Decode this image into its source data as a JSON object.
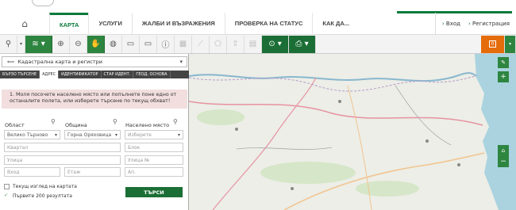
{
  "header": {
    "nav": [
      {
        "label": "КАРТА",
        "active": true
      },
      {
        "label": "УСЛУГИ"
      },
      {
        "label": "ЖАЛБИ И ВЪЗРАЖЕНИЯ"
      },
      {
        "label": "ПРОВЕРКА НА СТАТУС"
      },
      {
        "label": "КАК ДА..."
      }
    ],
    "login_label": "Вход",
    "register_label": "Регистрация"
  },
  "toolbar": {
    "counter": "0"
  },
  "panel": {
    "layer_select": "Кадастрална карта и регистри",
    "tabs": [
      "БЪРЗО ТЪРСЕНЕ",
      "АДРЕС",
      "ИДЕНТИФИКАТОР",
      "СТАР ИДЕНТ.",
      "ГЕОД. ОСНОВА"
    ],
    "warning": "1. Моля посочете населено място или попълнете поне едно от останалите полета, или изберете търсене по текущ обхват!",
    "oblast_label": "Област",
    "oblast_value": "Велико Търново",
    "obshtina_label": "Община",
    "obshtina_value": "Горна Оряховица",
    "naseleno_label": "Населено място",
    "naseleno_placeholder": "Изберете",
    "kvartal_placeholder": "Квартал",
    "blok_placeholder": "Блок",
    "ulitsa_placeholder": "Улица",
    "ulitsa_no_placeholder": "Улица №",
    "vhod_placeholder": "Вход",
    "etazh_placeholder": "Етаж",
    "ap_placeholder": "Ап.",
    "current_view_label": "Текущ изглед на картата",
    "first200_label": "Първите 200 резултата",
    "search_label": "ТЪРСИ"
  },
  "colors": {
    "brand_green": "#0a7a3b",
    "button_green": "#2e8540",
    "orange": "#e46c0a",
    "warning_bg": "#f2dede"
  }
}
